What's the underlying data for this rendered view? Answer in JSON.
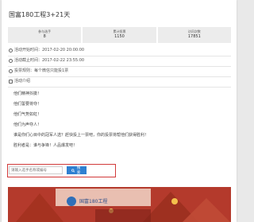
{
  "page": {
    "title": "国富180工程3+21天"
  },
  "stats": [
    {
      "label": "参与选手",
      "value": "8"
    },
    {
      "label": "累计投票",
      "value": "1150"
    },
    {
      "label": "访问次数",
      "value": "17851"
    }
  ],
  "info": {
    "start": "活动开始时间：2017-02-20 20:00:00",
    "end": "活动截止时间：2017-02-22 23:55:00",
    "rule": "投票规则：每个微信只能投1票",
    "section_title": "活动介绍"
  },
  "intro_lines": [
    "他们精神抖擞！",
    "他们誓要将夺！",
    "他们气势如虹！",
    "他们为声夺人！",
    "谁是你们心目中的冠军人选？赶快投上一票吧，你的投票将帮他们获得胜利！",
    "胜利者是：谁与争锋！人品爆发吧！"
  ],
  "search": {
    "placeholder": "请输入选手名称或编号",
    "button_label": "搜索"
  },
  "banner": {
    "logo_text": "国富180工程"
  },
  "colors": {
    "search_highlight": "#d23a3a",
    "search_button": "#2f80d1",
    "stat_bg": "#ececec"
  }
}
